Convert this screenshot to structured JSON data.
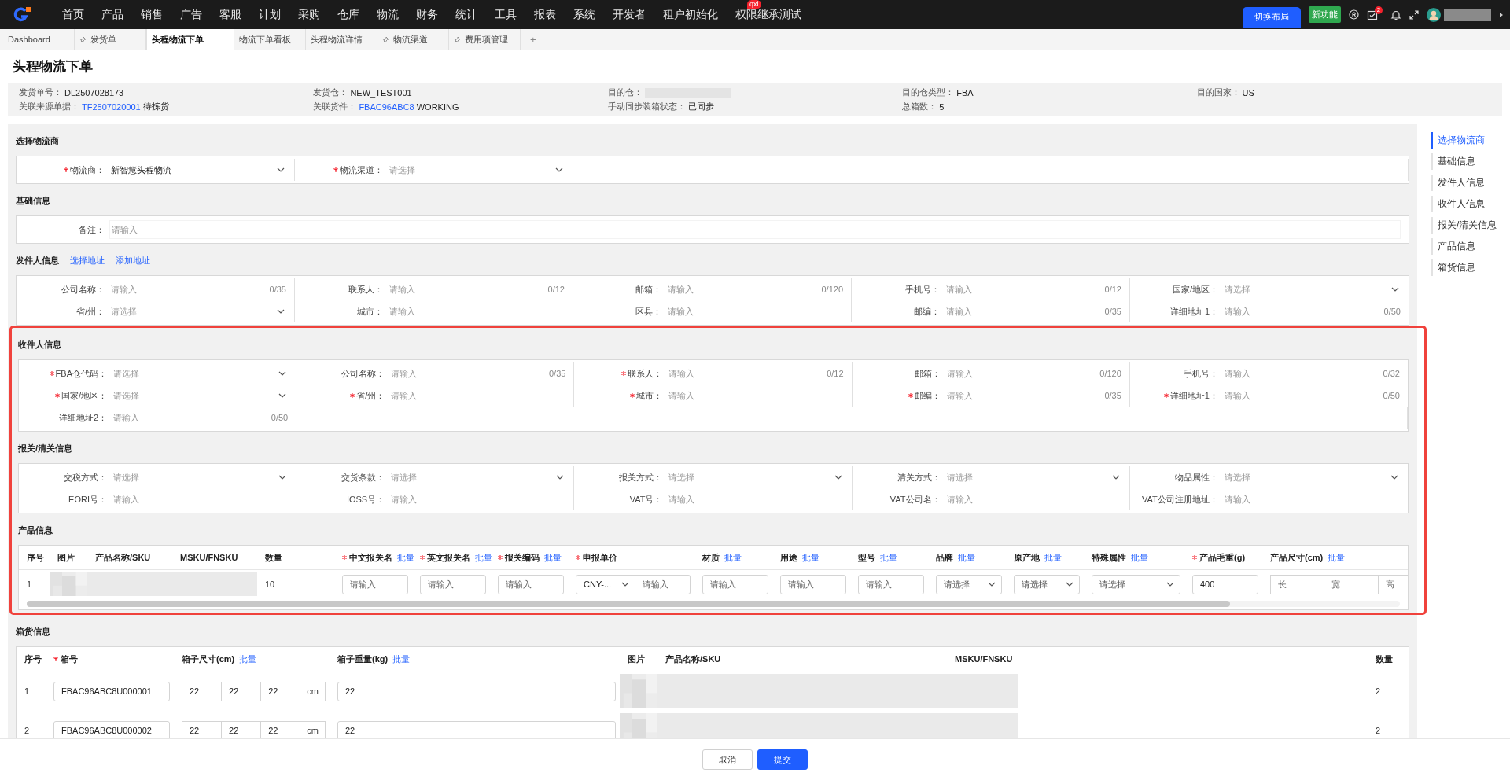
{
  "nav": {
    "menu": [
      {
        "label": "首页"
      },
      {
        "label": "产品"
      },
      {
        "label": "销售"
      },
      {
        "label": "广告"
      },
      {
        "label": "客服"
      },
      {
        "label": "计划"
      },
      {
        "label": "采购"
      },
      {
        "label": "仓库"
      },
      {
        "label": "物流"
      },
      {
        "label": "财务"
      },
      {
        "label": "统计"
      },
      {
        "label": "工具"
      },
      {
        "label": "报表"
      },
      {
        "label": "系统"
      },
      {
        "label": "开发者"
      },
      {
        "label": "租户初始化"
      },
      {
        "label": "权限继承测试",
        "badge": "qxi"
      }
    ],
    "layout_button": "切换布局",
    "new_feature": "新功能",
    "notification_count": "2"
  },
  "tabs": {
    "items": [
      {
        "label": "Dashboard",
        "pinned": false,
        "selected": false
      },
      {
        "label": "发货单",
        "pinned": true,
        "selected": false
      },
      {
        "label": "头程物流下单",
        "pinned": false,
        "selected": true
      },
      {
        "label": "物流下单看板",
        "pinned": false,
        "selected": false
      },
      {
        "label": "头程物流详情",
        "pinned": false,
        "selected": false
      },
      {
        "label": "物流渠道",
        "pinned": true,
        "selected": false
      },
      {
        "label": "费用项管理",
        "pinned": true,
        "selected": false
      }
    ],
    "add": "+"
  },
  "page_title": "头程物流下单",
  "summary": [
    {
      "label": "发货单号：",
      "value": "DL2507028173"
    },
    {
      "label": "发货仓：",
      "value": "NEW_TEST001"
    },
    {
      "label": "目的仓：",
      "kind": "redacted"
    },
    {
      "label": "目的仓类型：",
      "value": "FBA"
    },
    {
      "label": "目的国家：",
      "value": "US"
    },
    {
      "label": "关联来源单据：",
      "link": "TF2507020001",
      "value": "待拣货"
    },
    {
      "label": "关联货件：",
      "link": "FBAC96ABC8",
      "value": "WORKING"
    },
    {
      "label": "手动同步装箱状态：",
      "value": "已同步"
    },
    {
      "label": "总箱数：",
      "value": "5"
    }
  ],
  "sections": [
    {
      "title": "选择物流商",
      "kind": "form",
      "highlighted": false,
      "fields": [
        {
          "label": "物流商：",
          "required": true,
          "kind": "select",
          "value": "新智慧头程物流"
        },
        {
          "label": "物流渠道：",
          "required": true,
          "kind": "select",
          "placeholder": "请选择"
        }
      ]
    },
    {
      "title": "基础信息",
      "kind": "form",
      "highlighted": false,
      "fields": [
        {
          "label": "备注：",
          "required": false,
          "kind": "remark",
          "placeholder": "请输入"
        }
      ]
    },
    {
      "title": "发件人信息",
      "kind": "form",
      "highlighted": false,
      "links": [
        "选择地址",
        "添加地址"
      ],
      "fields": [
        {
          "label": "公司名称：",
          "required": false,
          "kind": "input",
          "placeholder": "请输入",
          "counter": "0/35"
        },
        {
          "label": "联系人：",
          "required": false,
          "kind": "input",
          "placeholder": "请输入",
          "counter": "0/12"
        },
        {
          "label": "邮箱：",
          "required": false,
          "kind": "input",
          "placeholder": "请输入",
          "counter": "0/120"
        },
        {
          "label": "手机号：",
          "required": false,
          "kind": "input",
          "placeholder": "请输入",
          "counter": "0/12"
        },
        {
          "label": "国家/地区：",
          "required": false,
          "kind": "select",
          "placeholder": "请选择"
        },
        {
          "label": "省/州：",
          "required": false,
          "kind": "select",
          "placeholder": "请选择"
        },
        {
          "label": "城市：",
          "required": false,
          "kind": "input",
          "placeholder": "请输入"
        },
        {
          "label": "区县：",
          "required": false,
          "kind": "input",
          "placeholder": "请输入"
        },
        {
          "label": "邮编：",
          "required": false,
          "kind": "input",
          "placeholder": "请输入",
          "counter": "0/35"
        },
        {
          "label": "详细地址1：",
          "required": false,
          "kind": "input",
          "placeholder": "请输入",
          "counter": "0/50"
        }
      ]
    },
    {
      "title": "收件人信息",
      "kind": "form",
      "highlighted": true,
      "fields": [
        {
          "label": "FBA仓代码：",
          "required": true,
          "kind": "select",
          "placeholder": "请选择"
        },
        {
          "label": "公司名称：",
          "required": false,
          "kind": "input",
          "placeholder": "请输入",
          "counter": "0/35"
        },
        {
          "label": "联系人：",
          "required": true,
          "kind": "input",
          "placeholder": "请输入",
          "counter": "0/12"
        },
        {
          "label": "邮箱：",
          "required": false,
          "kind": "input",
          "placeholder": "请输入",
          "counter": "0/120"
        },
        {
          "label": "手机号：",
          "required": false,
          "kind": "input",
          "placeholder": "请输入",
          "counter": "0/32"
        },
        {
          "label": "国家/地区：",
          "required": true,
          "kind": "select",
          "placeholder": "请选择"
        },
        {
          "label": "省/州：",
          "required": true,
          "kind": "input",
          "placeholder": "请输入"
        },
        {
          "label": "城市：",
          "required": true,
          "kind": "input",
          "placeholder": "请输入"
        },
        {
          "label": "邮编：",
          "required": true,
          "kind": "input",
          "placeholder": "请输入",
          "counter": "0/35"
        },
        {
          "label": "详细地址1：",
          "required": true,
          "kind": "input",
          "placeholder": "请输入",
          "counter": "0/50"
        },
        {
          "label": "详细地址2：",
          "required": false,
          "kind": "input",
          "placeholder": "请输入",
          "counter": "0/50"
        }
      ]
    },
    {
      "title": "报关/清关信息",
      "kind": "form",
      "highlighted": true,
      "fields": [
        {
          "label": "交税方式：",
          "required": false,
          "kind": "select",
          "placeholder": "请选择"
        },
        {
          "label": "交货条款：",
          "required": false,
          "kind": "select",
          "placeholder": "请选择"
        },
        {
          "label": "报关方式：",
          "required": false,
          "kind": "select",
          "placeholder": "请选择"
        },
        {
          "label": "清关方式：",
          "required": false,
          "kind": "select",
          "placeholder": "请选择"
        },
        {
          "label": "物品属性：",
          "required": false,
          "kind": "select",
          "placeholder": "请选择"
        },
        {
          "label": "EORI号：",
          "required": false,
          "kind": "input",
          "placeholder": "请输入"
        },
        {
          "label": "IOSS号：",
          "required": false,
          "kind": "input",
          "placeholder": "请输入"
        },
        {
          "label": "VAT号：",
          "required": false,
          "kind": "input",
          "placeholder": "请输入"
        },
        {
          "label": "VAT公司名：",
          "required": false,
          "kind": "input",
          "placeholder": "请输入"
        },
        {
          "label": "VAT公司注册地址：",
          "required": false,
          "kind": "input",
          "placeholder": "请输入"
        }
      ]
    },
    {
      "title": "产品信息",
      "kind": "products",
      "highlighted": true,
      "columns": [
        {
          "label": "序号",
          "required": false
        },
        {
          "label": "图片",
          "required": false
        },
        {
          "label": "产品名称/SKU",
          "required": false
        },
        {
          "label": "MSKU/FNSKU",
          "required": false
        },
        {
          "label": "数量",
          "required": false
        },
        {
          "label": "中文报关名",
          "required": true,
          "batch": "批量"
        },
        {
          "label": "英文报关名",
          "required": true,
          "batch": "批量"
        },
        {
          "label": "报关编码",
          "required": true,
          "batch": "批量"
        },
        {
          "label": "申报单价",
          "required": true
        },
        {
          "label": "材质",
          "required": false,
          "batch": "批量"
        },
        {
          "label": "用途",
          "required": false,
          "batch": "批量"
        },
        {
          "label": "型号",
          "required": false,
          "batch": "批量"
        },
        {
          "label": "品牌",
          "required": false,
          "batch": "批量"
        },
        {
          "label": "原产地",
          "required": false,
          "batch": "批量"
        },
        {
          "label": "特殊属性",
          "required": false,
          "batch": "批量"
        },
        {
          "label": "产品毛重(g)",
          "required": true
        },
        {
          "label": "产品尺寸(cm)",
          "required": false,
          "batch": "批量"
        }
      ],
      "rows": [
        {
          "cells": [
            {
              "kind": "text",
              "text": "1"
            },
            {
              "kind": "picture"
            },
            {
              "kind": "redacted"
            },
            {
              "kind": "redacted"
            },
            {
              "kind": "text",
              "text": "10"
            },
            {
              "kind": "input",
              "placeholder": "请输入"
            },
            {
              "kind": "input",
              "placeholder": "请输入"
            },
            {
              "kind": "input",
              "placeholder": "请输入"
            },
            {
              "kind": "price",
              "currency": "CNY-...",
              "placeholder": "请输入"
            },
            {
              "kind": "input",
              "placeholder": "请输入"
            },
            {
              "kind": "input",
              "placeholder": "请输入"
            },
            {
              "kind": "input",
              "placeholder": "请输入"
            },
            {
              "kind": "select",
              "placeholder": "请选择"
            },
            {
              "kind": "select",
              "placeholder": "请选择"
            },
            {
              "kind": "select",
              "placeholder": "请选择"
            },
            {
              "kind": "input",
              "value": "400"
            },
            {
              "kind": "dims",
              "parts": [
                {
                  "placeholder": "长"
                },
                {
                  "placeholder": "宽"
                },
                {
                  "placeholder": "高"
                }
              ]
            }
          ]
        }
      ]
    },
    {
      "title": "箱货信息",
      "kind": "boxes",
      "highlighted": false,
      "columns": [
        {
          "label": "序号",
          "required": false
        },
        {
          "label": "箱号",
          "required": true
        },
        {
          "label": "箱子尺寸(cm)",
          "required": false,
          "batch": "批量"
        },
        {
          "label": "箱子重量(kg)",
          "required": false,
          "batch": "批量"
        },
        {
          "label": "图片",
          "required": false
        },
        {
          "label": "产品名称/SKU",
          "required": false
        },
        {
          "label": "MSKU/FNSKU",
          "required": false
        },
        {
          "label": "数量",
          "required": false
        }
      ],
      "rows": [
        {
          "cells": [
            {
              "kind": "text",
              "text": "1"
            },
            {
              "kind": "input",
              "value": "FBAC96ABC8U000001"
            },
            {
              "kind": "dims",
              "parts": [
                {
                  "value": "22"
                },
                {
                  "value": "22"
                },
                {
                  "value": "22"
                }
              ],
              "unit": "cm"
            },
            {
              "kind": "input",
              "value": "22"
            },
            {
              "kind": "picture"
            },
            {
              "kind": "redacted"
            },
            {
              "kind": "redacted"
            },
            {
              "kind": "text",
              "text": "2"
            }
          ]
        },
        {
          "cells": [
            {
              "kind": "text",
              "text": "2"
            },
            {
              "kind": "input",
              "value": "FBAC96ABC8U000002"
            },
            {
              "kind": "dims",
              "parts": [
                {
                  "value": "22"
                },
                {
                  "value": "22"
                },
                {
                  "value": "22"
                }
              ],
              "unit": "cm"
            },
            {
              "kind": "input",
              "value": "22"
            },
            {
              "kind": "picture"
            },
            {
              "kind": "redacted"
            },
            {
              "kind": "redacted"
            },
            {
              "kind": "text",
              "text": "2"
            }
          ]
        }
      ]
    }
  ],
  "anchors": [
    {
      "label": "选择物流商",
      "selected": true
    },
    {
      "label": "基础信息",
      "selected": false
    },
    {
      "label": "发件人信息",
      "selected": false
    },
    {
      "label": "收件人信息",
      "selected": false
    },
    {
      "label": "报关/清关信息",
      "selected": false
    },
    {
      "label": "产品信息",
      "selected": false
    },
    {
      "label": "箱货信息",
      "selected": false
    }
  ],
  "footer": {
    "buttons": [
      {
        "label": "取消",
        "kind": "default"
      },
      {
        "label": "提交",
        "kind": "primary"
      }
    ]
  }
}
